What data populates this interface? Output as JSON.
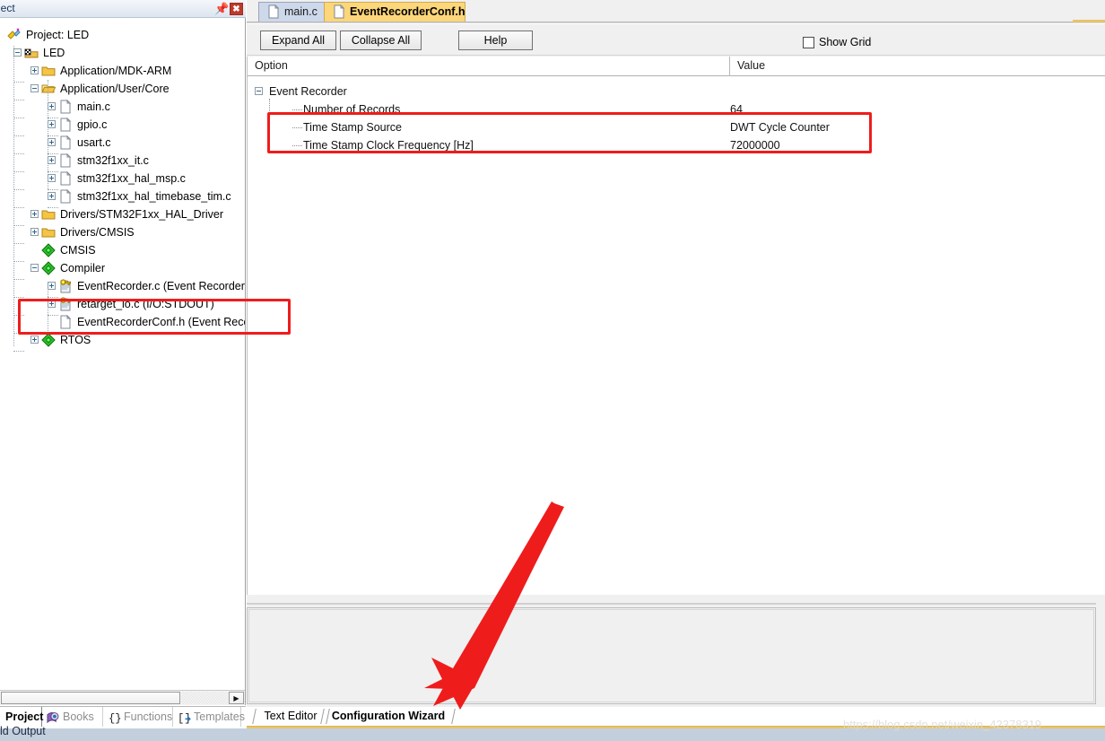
{
  "project_panel": {
    "title": "ject",
    "pin_icon": "pin-icon",
    "close_icon": "close-icon",
    "tree": [
      {
        "label": "Project: LED",
        "icon": "project-icon",
        "indent": 0,
        "expander": "none"
      },
      {
        "label": "LED",
        "icon": "target-icon",
        "indent": 1,
        "expander": "minus"
      },
      {
        "label": "Application/MDK-ARM",
        "icon": "folder-closed-icon",
        "indent": 2,
        "expander": "plus"
      },
      {
        "label": "Application/User/Core",
        "icon": "folder-open-icon",
        "indent": 2,
        "expander": "minus"
      },
      {
        "label": "main.c",
        "icon": "c-file-icon",
        "indent": 3,
        "expander": "plus"
      },
      {
        "label": "gpio.c",
        "icon": "c-file-icon",
        "indent": 3,
        "expander": "plus"
      },
      {
        "label": "usart.c",
        "icon": "c-file-icon",
        "indent": 3,
        "expander": "plus"
      },
      {
        "label": "stm32f1xx_it.c",
        "icon": "c-file-icon",
        "indent": 3,
        "expander": "plus"
      },
      {
        "label": "stm32f1xx_hal_msp.c",
        "icon": "c-file-icon",
        "indent": 3,
        "expander": "plus"
      },
      {
        "label": "stm32f1xx_hal_timebase_tim.c",
        "icon": "c-file-icon",
        "indent": 3,
        "expander": "plus"
      },
      {
        "label": "Drivers/STM32F1xx_HAL_Driver",
        "icon": "folder-closed-icon",
        "indent": 2,
        "expander": "plus"
      },
      {
        "label": "Drivers/CMSIS",
        "icon": "folder-closed-icon",
        "indent": 2,
        "expander": "plus"
      },
      {
        "label": "CMSIS",
        "icon": "component-diamond-icon",
        "indent": 2,
        "expander": "none"
      },
      {
        "label": "Compiler",
        "icon": "component-diamond-icon",
        "indent": 2,
        "expander": "minus"
      },
      {
        "label": "EventRecorder.c (Event Recorder)",
        "icon": "key-file-icon",
        "indent": 3,
        "expander": "plus"
      },
      {
        "label": "retarget_io.c (I/O:STDOUT)",
        "icon": "key-file-icon",
        "indent": 3,
        "expander": "plus"
      },
      {
        "label": "EventRecorderConf.h (Event Record",
        "icon": "plain-file-icon",
        "indent": 3,
        "expander": "none"
      },
      {
        "label": "RTOS",
        "icon": "component-diamond-icon",
        "indent": 2,
        "expander": "plus"
      }
    ],
    "bottom_tabs": [
      {
        "label": "Project",
        "icon": "",
        "active": true
      },
      {
        "label": "Books",
        "icon": "books-icon",
        "active": false
      },
      {
        "label": "Functions",
        "icon": "braces-icon",
        "active": false
      },
      {
        "label": "Templates",
        "icon": "templates-icon",
        "active": false
      }
    ]
  },
  "editor": {
    "tabs": [
      {
        "label": "main.c",
        "icon": "c-file-icon",
        "active": false
      },
      {
        "label": "EventRecorderConf.h",
        "icon": "h-file-icon",
        "active": true
      }
    ],
    "toolbar": {
      "expand_all": "Expand All",
      "collapse_all": "Collapse All",
      "help": "Help",
      "show_grid": "Show Grid",
      "show_grid_checked": false
    },
    "grid": {
      "columns": [
        "Option",
        "Value"
      ],
      "rows": [
        {
          "option": "Event Recorder",
          "value": "",
          "level": 0,
          "expander": "minus"
        },
        {
          "option": "Number of Records",
          "value": "64",
          "level": 1,
          "expander": "none"
        },
        {
          "option": "Time Stamp Source",
          "value": "DWT Cycle Counter",
          "level": 1,
          "expander": "none"
        },
        {
          "option": "Time Stamp Clock Frequency [Hz]",
          "value": "72000000",
          "level": 1,
          "expander": "none"
        }
      ]
    },
    "bottom_tabs": [
      {
        "label": "Text Editor",
        "active": false
      },
      {
        "label": "Configuration Wizard",
        "active": true
      }
    ]
  },
  "status": {
    "build_output": "ld Output",
    "watermark": "https://blog.csdn.net/weixin_42378319"
  },
  "annotations": {
    "highlight_rows_label": "red-highlight-rows",
    "highlight_tree_label": "red-highlight-tree",
    "arrow_label": "red-arrow-pointer",
    "accent_red": "#ef1c1c",
    "accent_tab_active": "#fcd67a",
    "accent_tab_inactive": "#cdd8ea"
  }
}
